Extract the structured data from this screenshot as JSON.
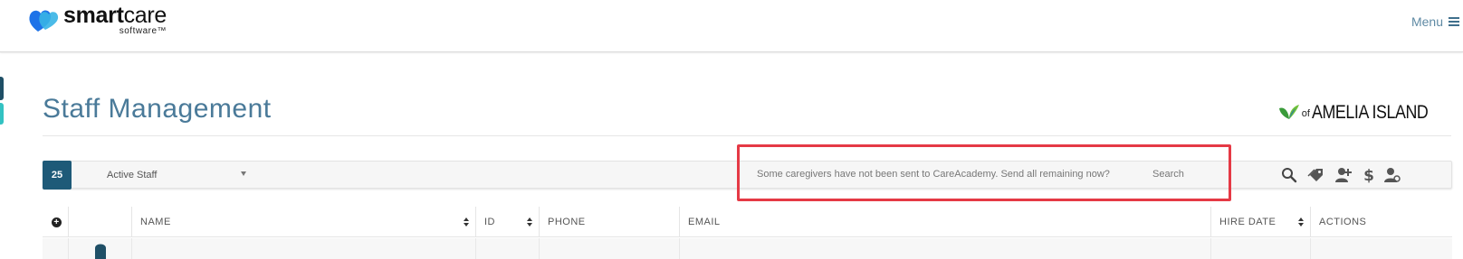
{
  "header": {
    "logo_brand_bold": "smart",
    "logo_brand_light": "care",
    "logo_sub": "software™",
    "menu_label": "Menu"
  },
  "page": {
    "title": "Staff Management"
  },
  "client_logo": {
    "prefix": "of",
    "name": "AMELIA ISLAND"
  },
  "toolbar": {
    "count": "25",
    "filter_value": "Active Staff",
    "careacademy_link": "Some caregivers have not been sent to CareAcademy. Send all remaining now?",
    "search_placeholder": "Search",
    "icons": [
      "search-icon",
      "tags-icon",
      "add-user-icon",
      "dollar-icon",
      "user-manage-icon"
    ]
  },
  "table": {
    "columns": [
      "",
      "",
      "NAME",
      "ID",
      "PHONE",
      "EMAIL",
      "HIRE DATE",
      "ACTIONS"
    ]
  },
  "colors": {
    "title": "#4a7a99",
    "badge": "#1e5a78",
    "highlight": "#e53945",
    "logo_blue": "#1e73e8"
  }
}
